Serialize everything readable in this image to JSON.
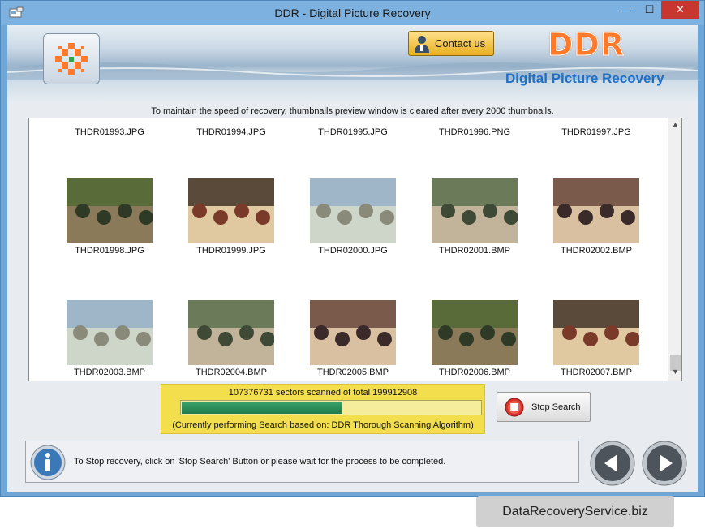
{
  "window": {
    "title": "DDR - Digital Picture Recovery",
    "minimize_glyph": "—",
    "maximize_glyph": "☐",
    "close_glyph": "✕"
  },
  "banner": {
    "contact_label": "Contact us",
    "brand": "DDR",
    "app_name": "Digital Picture Recovery"
  },
  "notice": "To maintain the speed of recovery, thumbnails preview window is cleared after every 2000 thumbnails.",
  "thumbnails": [
    {
      "name": "THDR01993.JPG"
    },
    {
      "name": "THDR01994.JPG"
    },
    {
      "name": "THDR01995.JPG"
    },
    {
      "name": "THDR01996.PNG"
    },
    {
      "name": "THDR01997.JPG"
    },
    {
      "name": "THDR01998.JPG"
    },
    {
      "name": "THDR01999.JPG"
    },
    {
      "name": "THDR02000.JPG"
    },
    {
      "name": "THDR02001.BMP"
    },
    {
      "name": "THDR02002.BMP"
    },
    {
      "name": "THDR02003.BMP"
    },
    {
      "name": "THDR02004.BMP"
    },
    {
      "name": "THDR02005.BMP"
    },
    {
      "name": "THDR02006.BMP"
    },
    {
      "name": "THDR02007.BMP"
    }
  ],
  "scan": {
    "sectors_text": "107376731 sectors scanned of total 199912908",
    "progress": 0.537,
    "algorithm_text": "(Currently performing Search based on:  DDR Thorough Scanning Algorithm)"
  },
  "stop_search_label": "Stop Search",
  "info_text": "To Stop recovery, click on 'Stop Search' Button or please wait for the process to be completed.",
  "watermark": "DataRecoveryService.biz",
  "colors": {
    "accent_orange": "#ff7a2a",
    "app_name_blue": "#1e6fc6",
    "status_yellow": "#f3df4d",
    "progress_green": "#1f7a4a"
  }
}
